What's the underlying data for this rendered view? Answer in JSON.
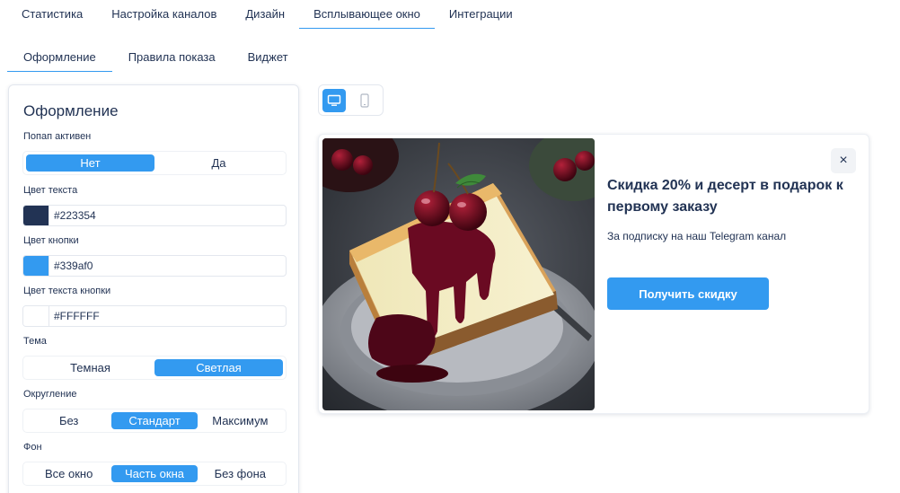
{
  "top_tabs": [
    "Статистика",
    "Настройка каналов",
    "Дизайн",
    "Всплывающее окно",
    "Интеграции"
  ],
  "top_tabs_active": "Всплывающее окно",
  "sub_tabs": [
    "Оформление",
    "Правила показа",
    "Виджет"
  ],
  "sub_tabs_active": "Оформление",
  "panel": {
    "title": "Оформление",
    "popup_active": {
      "label": "Попап активен",
      "options": [
        "Нет",
        "Да"
      ],
      "selected": "Нет"
    },
    "text_color": {
      "label": "Цвет текста",
      "value": "#223354"
    },
    "button_color": {
      "label": "Цвет кнопки",
      "value": "#339af0"
    },
    "button_text_color": {
      "label": "Цвет текста кнопки",
      "value": "#FFFFFF"
    },
    "theme": {
      "label": "Тема",
      "options": [
        "Темная",
        "Светлая"
      ],
      "selected": "Светлая"
    },
    "rounding": {
      "label": "Округление",
      "options": [
        "Без",
        "Стандарт",
        "Максимум"
      ],
      "selected": "Стандарт"
    },
    "background": {
      "label": "Фон",
      "options": [
        "Все окно",
        "Часть окна",
        "Без фона"
      ],
      "selected": "Часть окна"
    }
  },
  "device_toggle": {
    "options": [
      "desktop-icon",
      "mobile-icon"
    ],
    "selected": "desktop-icon"
  },
  "preview": {
    "image": "cheesecake-with-cherry-sauce",
    "title": "Скидка 20% и десерт в подарок к первому заказу",
    "subtitle": "За подписку на наш Telegram канал",
    "cta_label": "Получить скидку",
    "close_symbol": "×"
  },
  "colors": {
    "accent": "#339af0",
    "text": "#223354",
    "border": "#e3e7ee"
  }
}
